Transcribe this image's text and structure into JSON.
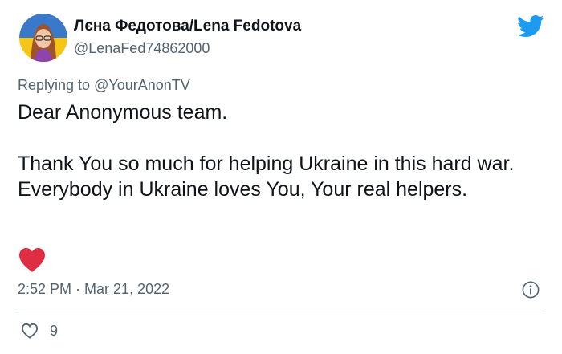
{
  "tweet": {
    "display_name": "Лєна Федотова/Lena Fedotova",
    "handle": "@LenaFed74862000",
    "replying_prefix": "Replying to ",
    "replying_to": "@YourAnonTV",
    "paragraphs": [
      "Dear Anonymous team.",
      "Thank You so much for helping Ukraine in this hard war. Everybody in Ukraine loves You, Your real helpers."
    ],
    "time": "2:52 PM",
    "separator": " · ",
    "date": "Mar 21, 2022",
    "like_count": "9"
  },
  "icons": {
    "logo": "twitter-bird-icon",
    "emoji": "red-heart-emoji",
    "info": "info-icon",
    "like": "heart-outline-icon"
  },
  "colors": {
    "twitter_blue": "#1d9bf0",
    "muted_text": "#536471",
    "heart_red": "#e0245e",
    "flag_blue": "#3a78c9",
    "flag_yellow": "#f5c518"
  }
}
